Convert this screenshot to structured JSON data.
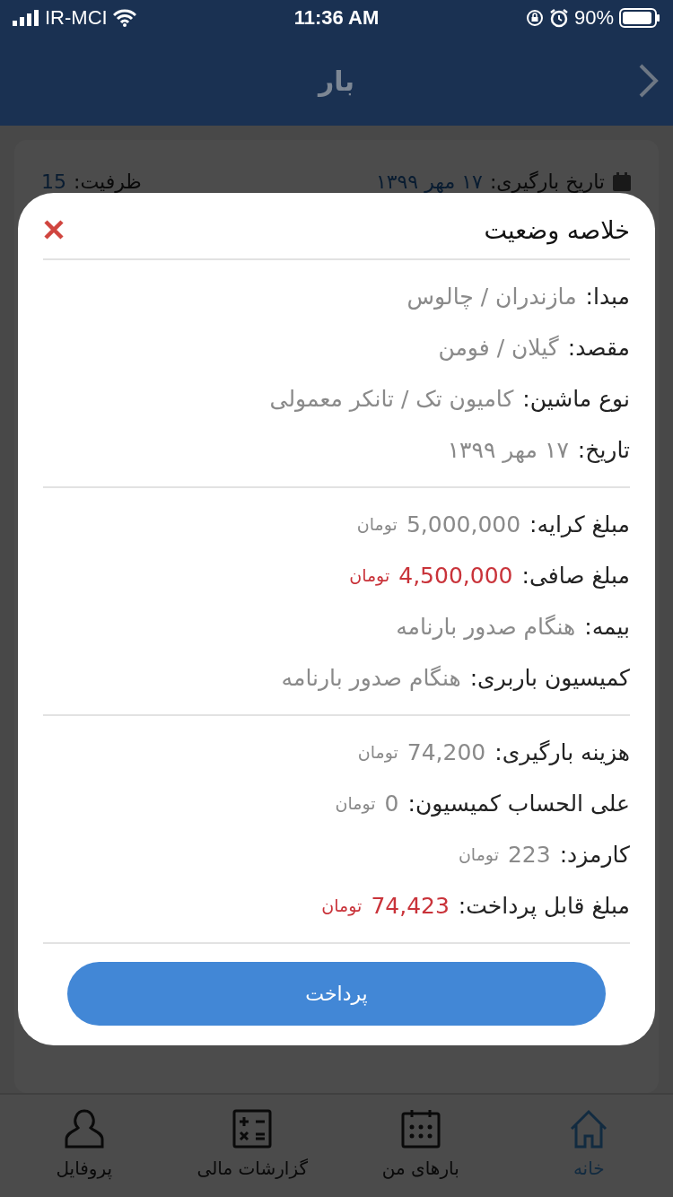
{
  "status_bar": {
    "carrier": "IR-MCI",
    "time": "11:36 AM",
    "battery": "90%"
  },
  "header": {
    "title": "بار"
  },
  "load_card": {
    "loading_date_label": "تاریخ بارگیری:",
    "loading_date": "۱۷ مهر ۱۳۹۹",
    "capacity_label": "ظرفیت:",
    "capacity": "15"
  },
  "dialog": {
    "title": "خلاصه وضعیت",
    "sections": [
      {
        "rows": [
          {
            "label": "مبدا:",
            "value": "مازندران / چالوس",
            "highlighted": false
          },
          {
            "label": "مقصد:",
            "value": "گیلان / فومن",
            "highlighted": false
          },
          {
            "label": "نوع ماشین:",
            "value": "کامیون تک / تانکر معمولی",
            "highlighted": false
          },
          {
            "label": "تاریخ:",
            "value": "۱۷ مهر ۱۳۹۹",
            "highlighted": false
          }
        ]
      },
      {
        "rows": [
          {
            "label": "مبلغ کرایه:",
            "value": "5,000,000",
            "unit": "تومان",
            "highlighted": false
          },
          {
            "label": "مبلغ صافی:",
            "value": "4,500,000",
            "unit": "تومان",
            "highlighted": true
          },
          {
            "label": "بیمه:",
            "value": "هنگام صدور بارنامه",
            "highlighted": false
          },
          {
            "label": "کمیسیون باربری:",
            "value": "هنگام صدور بارنامه",
            "highlighted": false
          }
        ]
      },
      {
        "rows": [
          {
            "label": "هزینه بارگیری:",
            "value": "74,200",
            "unit": "تومان",
            "highlighted": false
          },
          {
            "label": "علی الحساب کمیسیون:",
            "value": "0",
            "unit": "تومان",
            "highlighted": false
          },
          {
            "label": "کارمزد:",
            "value": "223",
            "unit": "تومان",
            "highlighted": false
          },
          {
            "label": "مبلغ قابل پرداخت:",
            "value": "74,423",
            "unit": "تومان",
            "highlighted": true
          }
        ]
      }
    ],
    "pay_button": "پرداخت"
  },
  "tab_bar": [
    {
      "label": "خانه",
      "selected": true
    },
    {
      "label": "بارهای من",
      "selected": false
    },
    {
      "label": "گزارشات مالی",
      "selected": false
    },
    {
      "label": "پروفایل",
      "selected": false
    }
  ]
}
